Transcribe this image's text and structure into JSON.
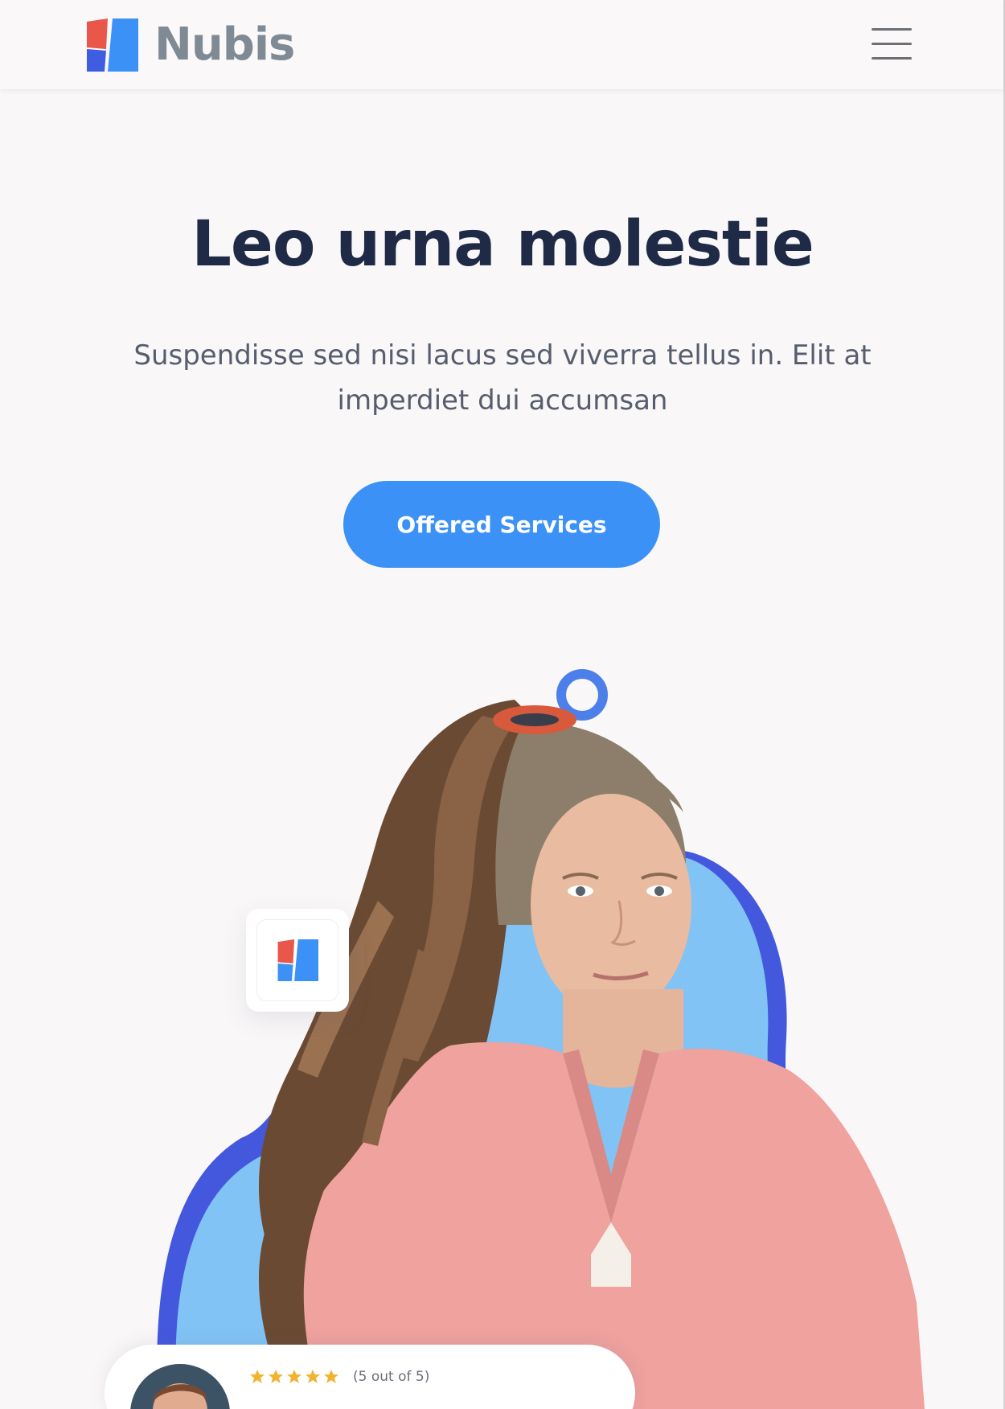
{
  "header": {
    "brand_name": "Nubis",
    "logo_icon": "nubis-logo-icon",
    "menu_icon": "hamburger-menu-icon"
  },
  "hero": {
    "title": "Leo urna molestie",
    "subtitle": "Suspendisse sed nisi lacus sed viverra tellus in. Elit at imperdiet dui accumsan",
    "cta_label": "Offered Services"
  },
  "review": {
    "rating": 5,
    "rating_max": 5,
    "rating_text": "(5 out of 5)"
  },
  "colors": {
    "accent_blue": "#3b91f5",
    "logo_red": "#e8574a",
    "logo_dark_blue": "#3f5de0",
    "logo_blue": "#3b91f5",
    "blob_light": "#82c3f5",
    "blob_dark": "#4458de",
    "title": "#1f2b46",
    "star": "#f2b430"
  }
}
